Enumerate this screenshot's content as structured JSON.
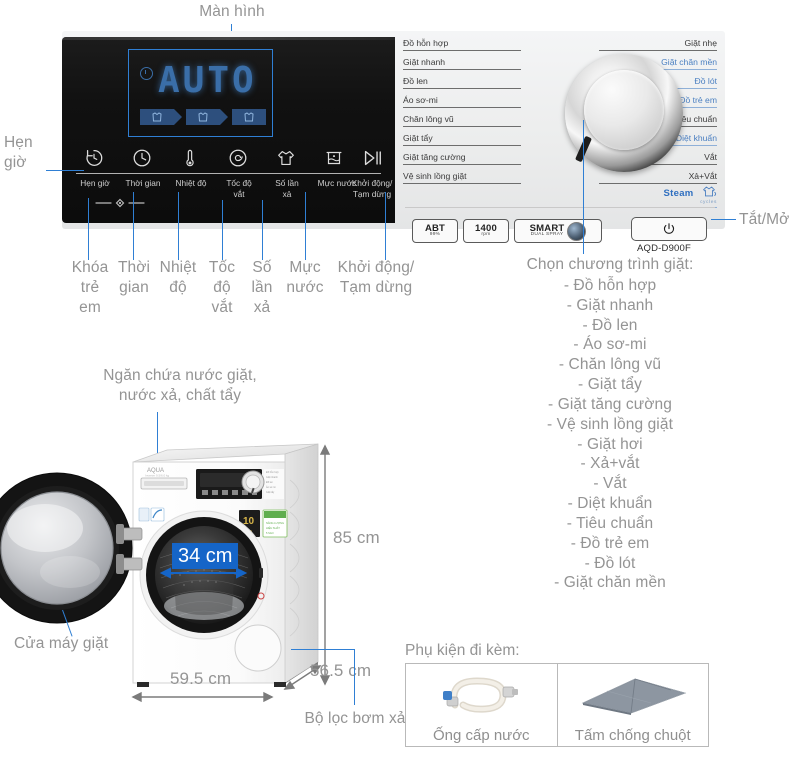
{
  "callouts": {
    "display": "Màn hình",
    "timer": "Hẹn\ngiờ",
    "power_toggle": "Tắt/Mở",
    "detergent_drawer": "Ngăn chứa nước giặt,\nnước xả, chất tẩy",
    "machine_door": "Cửa máy giặt",
    "drain_pump_filter": "Bộ lọc bơm xả"
  },
  "panel": {
    "display_value": "AUTO",
    "phase_chips": [
      "wash-phase-icon",
      "rinse-phase-icon",
      "spin-phase-icon"
    ],
    "buttons": [
      {
        "icon": "delay-timer-icon",
        "glyph": "↻",
        "label": "Hẹn giờ"
      },
      {
        "icon": "clock-icon",
        "glyph": "◴",
        "label": "Thời gian"
      },
      {
        "icon": "thermometer-icon",
        "glyph": " ",
        "label": "Nhiệt độ"
      },
      {
        "icon": "spin-spiral-icon",
        "glyph": "◎",
        "label": "Tốc độ\nvắt"
      },
      {
        "icon": "tshirt-rinse-icon",
        "glyph": " ",
        "label": "Số lần\nxả"
      },
      {
        "icon": "water-level-icon",
        "glyph": " ",
        "label": "Mực nước"
      },
      {
        "icon": "start-pause-icon",
        "glyph": "▷‖",
        "label": "Khởi động/\nTạm dừng"
      }
    ],
    "child_lock": "child-lock-icon"
  },
  "programs_panel": {
    "left_column": [
      {
        "label": "Đồ hỗn hợp",
        "color": "dark"
      },
      {
        "label": "Giặt nhanh",
        "color": "dark"
      },
      {
        "label": "Đồ len",
        "color": "dark"
      },
      {
        "label": "Áo sơ-mi",
        "color": "dark"
      },
      {
        "label": "Chăn lông vũ",
        "color": "dark"
      },
      {
        "label": "Giặt tẩy",
        "color": "dark"
      },
      {
        "label": "Giặt tăng cường",
        "color": "dark"
      },
      {
        "label": "Vệ sinh lồng giặt",
        "color": "dark"
      }
    ],
    "right_column": [
      {
        "label": "Giặt nhẹ",
        "color": "dark"
      },
      {
        "label": "Giặt chăn mền",
        "color": "blue"
      },
      {
        "label": "Đồ lót",
        "color": "blue"
      },
      {
        "label": "Đồ trẻ em",
        "color": "blue"
      },
      {
        "label": "Tiêu chuẩn",
        "color": "dark"
      },
      {
        "label": "Diệt khuẩn",
        "color": "blue"
      },
      {
        "label": "Vắt",
        "color": "dark"
      },
      {
        "label": "Xả+Vắt",
        "color": "dark"
      }
    ],
    "steam": {
      "main": "Steam",
      "sub": "cycles"
    },
    "badges": [
      {
        "main": "ABT",
        "sub": "99%"
      },
      {
        "main": "1400",
        "sub": "rpm"
      },
      {
        "main": "SMART",
        "sub": "DUAL SPRAY"
      }
    ],
    "power_icon": "power-icon",
    "model": "AQD-D900F"
  },
  "button_callout_labels": [
    "Khóa\ntrẻ\nem",
    "Thời\ngian",
    "Nhiệt\nđộ",
    "Tốc\nđộ\nvắt",
    "Số\nlần\nxả",
    "Mực\nnước",
    "Khởi động/\nTạm dừng"
  ],
  "program_list": {
    "heading": "Chọn chương trình giặt:",
    "items": [
      "- Đồ hỗn hợp",
      "- Giặt nhanh",
      "- Đồ len",
      "- Áo sơ-mi",
      "- Chăn lông vũ",
      "- Giặt tẩy",
      "- Giặt tăng cường",
      "- Vệ sinh lồng giặt",
      "- Giặt hơi",
      "- Xả+vắt",
      "- Vắt",
      "- Diệt khuẩn",
      "- Tiêu chuẩn",
      "- Đồ trẻ em",
      "- Đồ lót",
      "- Giặt chăn mền"
    ]
  },
  "dimensions": {
    "drum_opening": "34 cm",
    "height": "85 cm",
    "width": "59.5 cm",
    "depth": "56.5 cm"
  },
  "accessories": {
    "title": "Phụ kiện đi kèm:",
    "items": [
      {
        "label": "Ống cấp nước",
        "icon": "water-inlet-hose-icon"
      },
      {
        "label": "Tấm chống chuột",
        "icon": "anti-rodent-plate-icon"
      }
    ]
  },
  "machine_brand": "AQUA",
  "colors": {
    "callout_line": "#2f7fd4",
    "callout_text": "#949494",
    "panel_black": "#111111",
    "led_blue": "#3a6ea8",
    "highlight_blue": "#2f7fd4",
    "program_blue": "#4a7fc1"
  }
}
